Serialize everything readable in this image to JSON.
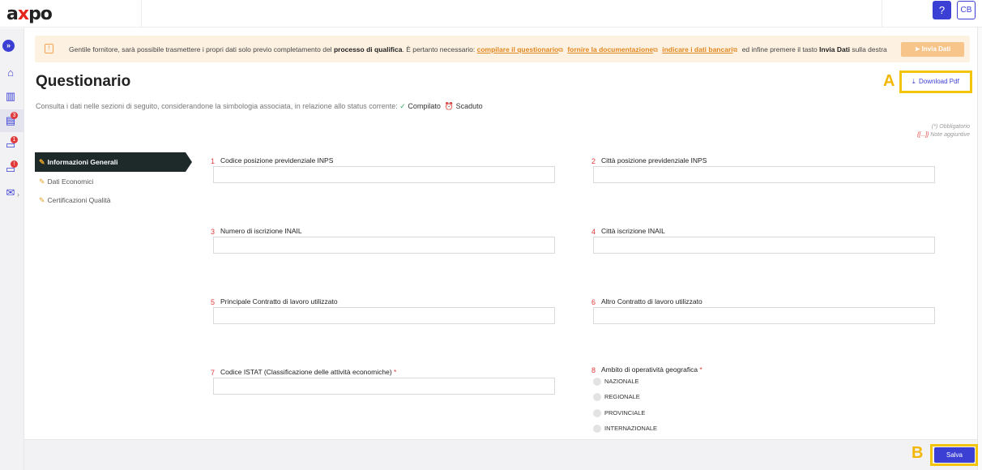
{
  "header": {
    "logo_prefix": "a",
    "logo_x": "x",
    "logo_suffix": "po",
    "help_label": "?",
    "user_initials": "CB"
  },
  "sidebar": {
    "expand_glyph": "»",
    "items": [
      {
        "icon": "home-icon",
        "glyph": "⌂"
      },
      {
        "icon": "buildings-icon",
        "glyph": "▥"
      },
      {
        "icon": "clipboard-icon",
        "glyph": "▤",
        "badge": "3"
      },
      {
        "icon": "folder-icon",
        "glyph": "▭",
        "badge": "1"
      },
      {
        "icon": "folder-alert-icon",
        "glyph": "▭",
        "badge": "!"
      },
      {
        "icon": "mail-icon",
        "glyph": "✉"
      }
    ],
    "chevron": "›"
  },
  "notice": {
    "text_1": "Gentile fornitore, sarà possibile trasmettere i propri dati solo previo completamento del ",
    "bold_1": "processo di qualifica",
    "text_2": ". È pertanto necessario: ",
    "link_1": "compilare il questionario",
    "link_2": "fornire la documentazione",
    "link_3": "indicare i dati bancari",
    "text_3": " ed infine premere il tasto ",
    "bold_2": "Invia Dati",
    "text_4": " sulla destra",
    "send_button": "Invia Dati",
    "icon_glyph": "!",
    "ext_glyph": "⧉",
    "send_glyph": "➤"
  },
  "page": {
    "title": "Questionario",
    "subtitle": "Consulta i dati nelle sezioni di seguito, considerandone la simbologia associata, in relazione allo status corrente: ",
    "status_ok_glyph": "✓",
    "status_ok": "Compilato",
    "status_expired_glyph": "⏰",
    "status_expired": "Scaduto",
    "download_label": "Download Pdf",
    "download_glyph": "⤓",
    "legend_required": "(*) Obbligatorio",
    "legend_notes_mark": "{[...]}",
    "legend_notes": " Note aggiuntive",
    "annotation_a": "A",
    "annotation_b": "B"
  },
  "tabs": [
    {
      "label": "Informazioni Generali",
      "active": true
    },
    {
      "label": "Dati Economici",
      "active": false
    },
    {
      "label": "Certificazioni Qualità",
      "active": false
    }
  ],
  "tab_glyph": "✎",
  "fields": [
    {
      "num": "1",
      "label": "Codice posizione previdenziale INPS",
      "value": "",
      "required": false
    },
    {
      "num": "2",
      "label": "Città posizione previdenziale INPS",
      "value": "",
      "required": false
    },
    {
      "num": "3",
      "label": "Numero di iscrizione INAIL",
      "value": "",
      "required": false
    },
    {
      "num": "4",
      "label": "Città iscrizione INAIL",
      "value": "",
      "required": false
    },
    {
      "num": "5",
      "label": "Principale Contratto di lavoro utilizzato",
      "value": "",
      "required": false
    },
    {
      "num": "6",
      "label": "Altro Contratto di lavoro utilizzato",
      "value": "",
      "required": false
    },
    {
      "num": "7",
      "label": "Codice ISTAT (Classificazione delle attività economiche)",
      "value": "",
      "required": true
    },
    {
      "num": "8",
      "label": "Ambito di operatività geografica",
      "required": true
    }
  ],
  "required_mark": "*",
  "geo_options": [
    "NAZIONALE",
    "REGIONALE",
    "PROVINCIALE",
    "INTERNAZIONALE"
  ],
  "footer": {
    "save_button": "Salva"
  }
}
